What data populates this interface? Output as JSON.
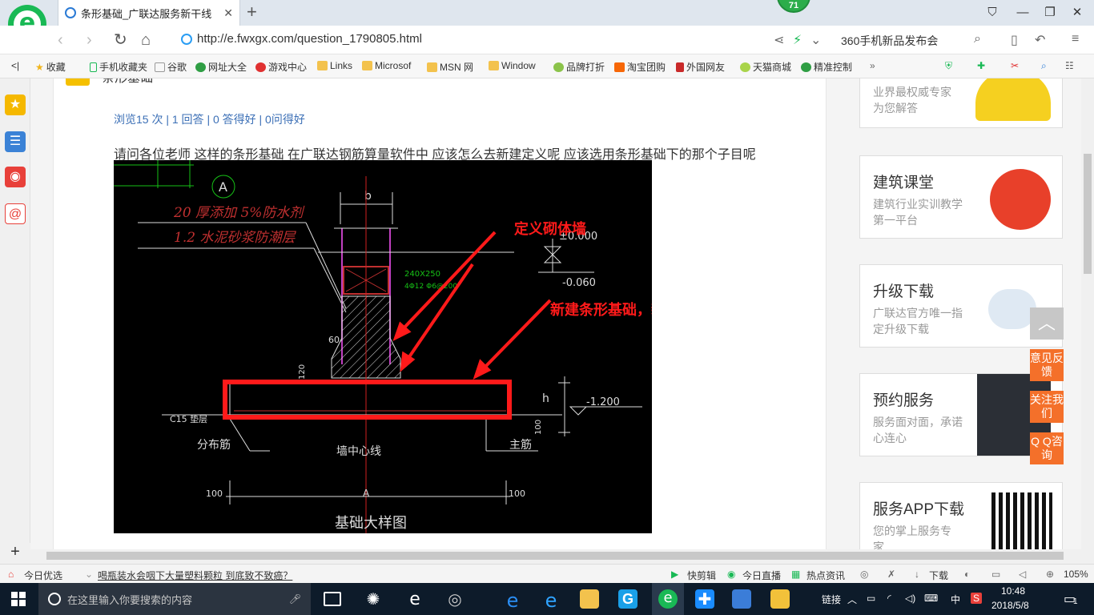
{
  "browser": {
    "tab_title": "条形基础_广联达服务新干线",
    "badge_count": "71",
    "url": "http://e.fwxgx.com/question_1790805.html",
    "search_text": "360手机新品发布会"
  },
  "bookmarks": [
    {
      "label": "收藏",
      "icon": "star-icon"
    },
    {
      "label": "手机收藏夹",
      "icon": "phone-icon"
    },
    {
      "label": "谷歌",
      "icon": "page-icon"
    },
    {
      "label": "网址大全",
      "icon": "globe-icon"
    },
    {
      "label": "游戏中心",
      "icon": "game-icon"
    },
    {
      "label": "Links",
      "icon": "folder-icon"
    },
    {
      "label": "Microsof",
      "icon": "folder-icon"
    },
    {
      "label": "MSN 网",
      "icon": "folder-icon"
    },
    {
      "label": "Window",
      "icon": "folder-icon"
    },
    {
      "label": "品牌打折",
      "icon": "leaf-icon"
    },
    {
      "label": "淘宝团购",
      "icon": "taobao-icon"
    },
    {
      "label": "外国网友",
      "icon": "book-icon"
    },
    {
      "label": "天猫商城",
      "icon": "leaf-icon"
    },
    {
      "label": "精准控制",
      "icon": "chat-icon"
    }
  ],
  "question": {
    "header_fragment": "条形基础",
    "stats": "浏览15 次 | 1 回答 | 0 答得好 | 0问得好",
    "text": "请问各位老师  这样的条形基础 在广联达钢筋算量软件中 应该怎么去新建定义呢  应该选用条形基础下的那个子目呢"
  },
  "drawing": {
    "axis_mark": "A",
    "note_line1": "20 厚添加  5%防水剂",
    "note_line2": "1.2  水泥砂浆防潮层",
    "dim_b": "b",
    "level_top": "±0.000",
    "level_mid": "-0.060",
    "level_bottom": "-1.200",
    "beam_label": "240X250",
    "beam_rebar": "4Φ12  Φ6@200",
    "dim_60": "60",
    "dim_120": "120",
    "cushion": "C15  垫层",
    "dist_bar": "分布筋",
    "main_bar": "主筋",
    "wall_center": "墙中心线",
    "dim_100_left": "100",
    "dim_100_right": "100",
    "dim_h": "h",
    "dim_100_v": "100",
    "axis_bottom": "A",
    "caption": "基础大样图",
    "annotation1": "定义砌体墙",
    "annotation2": "新建条形基础，新建矩形条形基础单元"
  },
  "aside": [
    {
      "title": "",
      "subtitle": "业界最权威专家为您解答"
    },
    {
      "title": "建筑课堂",
      "subtitle": "建筑行业实训教学第一平台"
    },
    {
      "title": "升级下载",
      "subtitle": "广联达官方唯一指定升级下载"
    },
    {
      "title": "预约服务",
      "subtitle": "服务面对面，承诺心连心"
    },
    {
      "title": "服务APP下载",
      "subtitle": "您的掌上服务专家"
    }
  ],
  "floating": [
    "意见反馈",
    "关注我们",
    "Q Q咨询"
  ],
  "statusbar": {
    "today": "今日优选",
    "news": "喝瓶装水会咽下大量塑料颗粒 到底致不致癌？",
    "quick_cut": "快剪辑",
    "live": "今日直播",
    "hot": "热点资讯",
    "download": "下载",
    "zoom": "105%"
  },
  "taskbar": {
    "search_placeholder": "在这里输入你要搜索的内容",
    "links": "链接",
    "ime": "中",
    "time": "10:48",
    "date": "2018/5/8",
    "notifications": "1"
  },
  "colors": {
    "accent_green": "#19b955",
    "link_blue": "#3b6fb6",
    "annotation_red": "#ff1a1a",
    "float_orange": "#f4702a"
  }
}
